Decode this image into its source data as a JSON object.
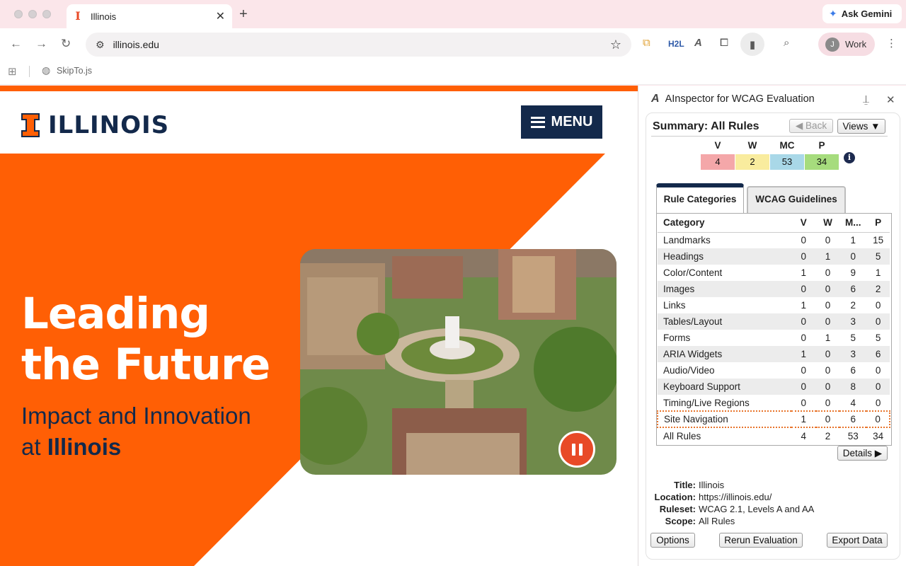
{
  "browser": {
    "tab_title": "Illinois",
    "new_tab_symbol": "+",
    "ask_gemini": "Ask Gemini",
    "url": "illinois.edu",
    "profile_initial": "J",
    "profile_label": "Work",
    "bookmark_label": "SkipTo.js"
  },
  "site": {
    "logo_text": "ILLINOIS",
    "menu_label": "MENU",
    "headline_line1": "Leading",
    "headline_line2": "the Future",
    "sub_line1": "Impact and Innovation",
    "sub_prefix": "at ",
    "sub_bold": "Illinois",
    "colors": {
      "orange": "#ff5f05",
      "navy": "#13294b"
    }
  },
  "panel": {
    "title": "AInspector for WCAG Evaluation",
    "summary_title": "Summary: All Rules",
    "back_label": "◀ Back",
    "views_label": "Views ▼",
    "summary": [
      {
        "label": "V",
        "value": "4",
        "color": "#f4a7a9"
      },
      {
        "label": "W",
        "value": "2",
        "color": "#f9ec9e"
      },
      {
        "label": "MC",
        "value": "53",
        "color": "#a9d8e8"
      },
      {
        "label": "P",
        "value": "34",
        "color": "#a6dc7d"
      }
    ],
    "tab_rule_categories": "Rule Categories",
    "tab_wcag_guidelines": "WCAG Guidelines",
    "table": {
      "headers": [
        "Category",
        "V",
        "W",
        "M...",
        "P"
      ],
      "rows": [
        [
          "Landmarks",
          "0",
          "0",
          "1",
          "15"
        ],
        [
          "Headings",
          "0",
          "1",
          "0",
          "5"
        ],
        [
          "Color/Content",
          "1",
          "0",
          "9",
          "1"
        ],
        [
          "Images",
          "0",
          "0",
          "6",
          "2"
        ],
        [
          "Links",
          "1",
          "0",
          "2",
          "0"
        ],
        [
          "Tables/Layout",
          "0",
          "0",
          "3",
          "0"
        ],
        [
          "Forms",
          "0",
          "1",
          "5",
          "5"
        ],
        [
          "ARIA Widgets",
          "1",
          "0",
          "3",
          "6"
        ],
        [
          "Audio/Video",
          "0",
          "0",
          "6",
          "0"
        ],
        [
          "Keyboard Support",
          "0",
          "0",
          "8",
          "0"
        ],
        [
          "Timing/Live Regions",
          "0",
          "0",
          "4",
          "0"
        ],
        [
          "Site Navigation",
          "1",
          "0",
          "6",
          "0"
        ],
        [
          "All Rules",
          "4",
          "2",
          "53",
          "34"
        ]
      ],
      "selected_row": 11
    },
    "details_label": "Details ▶",
    "meta": {
      "title_key": "Title:",
      "title_val": "Illinois",
      "location_key": "Location:",
      "location_val": "https://illinois.edu/",
      "ruleset_key": "Ruleset:",
      "ruleset_val": "WCAG 2.1, Levels A and AA",
      "scope_key": "Scope:",
      "scope_val": "All Rules"
    },
    "options_label": "Options",
    "rerun_label": "Rerun Evaluation",
    "export_label": "Export Data"
  }
}
